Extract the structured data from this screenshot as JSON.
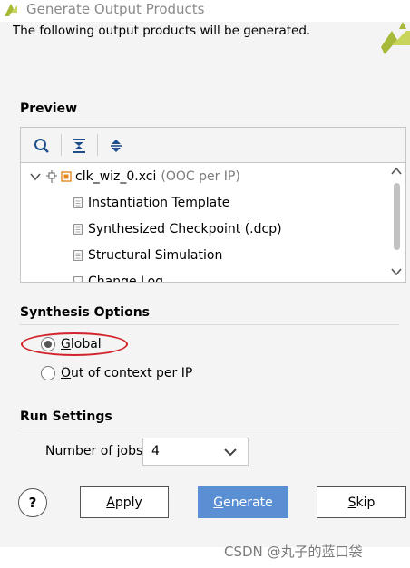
{
  "window": {
    "title": "Generate Output Products"
  },
  "description": "The following output products will be generated.",
  "preview": {
    "title": "Preview",
    "toolbar": [
      {
        "name": "search-icon"
      },
      {
        "name": "collapse-all-icon"
      },
      {
        "name": "expand-all-icon"
      }
    ],
    "tree": {
      "root_label": "clk_wiz_0.xci",
      "root_suffix": "(OOC per IP)",
      "children": [
        "Instantiation Template",
        "Synthesized Checkpoint (.dcp)",
        "Structural Simulation",
        "Change Log"
      ]
    }
  },
  "synthesis": {
    "title": "Synthesis Options",
    "options": [
      {
        "label_u": "G",
        "label_rest": "lobal",
        "selected": true
      },
      {
        "label_u": "O",
        "label_rest": "ut of context per IP",
        "selected": false
      }
    ]
  },
  "run": {
    "title": "Run Settings",
    "jobs_label": "Number of jobs:",
    "jobs_value": "4"
  },
  "buttons": {
    "help": "?",
    "apply_u": "A",
    "apply_rest": "pply",
    "generate_u": "G",
    "generate_rest": "enerate",
    "skip_u": "S",
    "skip_rest": "kip"
  },
  "watermark": "CSDN @丸子的蓝口袋",
  "colors": {
    "accent": "#5b8fd4",
    "annotation": "#d2232a",
    "logo": "#a8b838"
  }
}
